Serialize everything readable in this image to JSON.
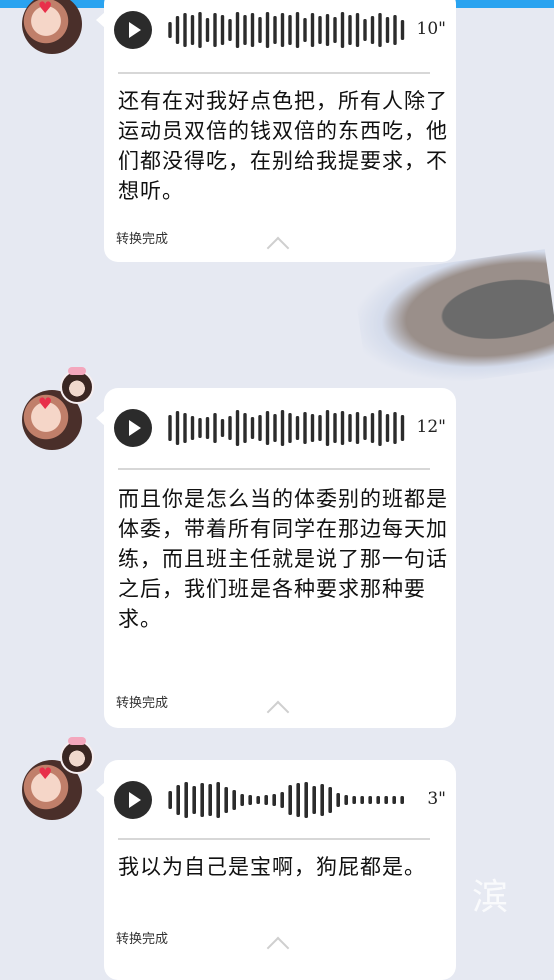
{
  "messages": [
    {
      "duration": "10\"",
      "text": "还有在对我好点色把，所有人除了运动员双倍的钱双倍的东西吃，他们都没得吃，在别给我提要求，不想听。",
      "status": "转换完成",
      "waveform": [
        16,
        28,
        34,
        30,
        36,
        24,
        34,
        30,
        22,
        36,
        30,
        34,
        26,
        36,
        28,
        34,
        30,
        36,
        24,
        34,
        28,
        32,
        26,
        36,
        30,
        34,
        22,
        28,
        34,
        26,
        30,
        20
      ]
    },
    {
      "duration": "12\"",
      "text": "而且你是怎么当的体委别的班都是体委，带着所有同学在那边每天加练，而且班主任就是说了那一句话之后，我们班是各种要求那种要求。",
      "status": "转换完成",
      "waveform": [
        26,
        34,
        30,
        24,
        20,
        22,
        30,
        18,
        24,
        36,
        30,
        22,
        26,
        34,
        28,
        36,
        30,
        24,
        32,
        28,
        26,
        36,
        30,
        34,
        28,
        32,
        24,
        30,
        36,
        28,
        32,
        26
      ]
    },
    {
      "duration": "3\"",
      "text": "我以为自己是宝啊，狗屁都是。",
      "status": "转换完成",
      "waveform": [
        18,
        30,
        36,
        28,
        34,
        32,
        36,
        26,
        20,
        12,
        10,
        8,
        10,
        12,
        16,
        30,
        34,
        36,
        28,
        32,
        26,
        14,
        10,
        8,
        8,
        8,
        8,
        8,
        8,
        8
      ]
    }
  ],
  "watermark": "滨",
  "colors": {
    "background": "#e6e9f2",
    "topbar": "#2aa3f0",
    "bubble": "#ffffff",
    "play": "#2b2b2b"
  }
}
